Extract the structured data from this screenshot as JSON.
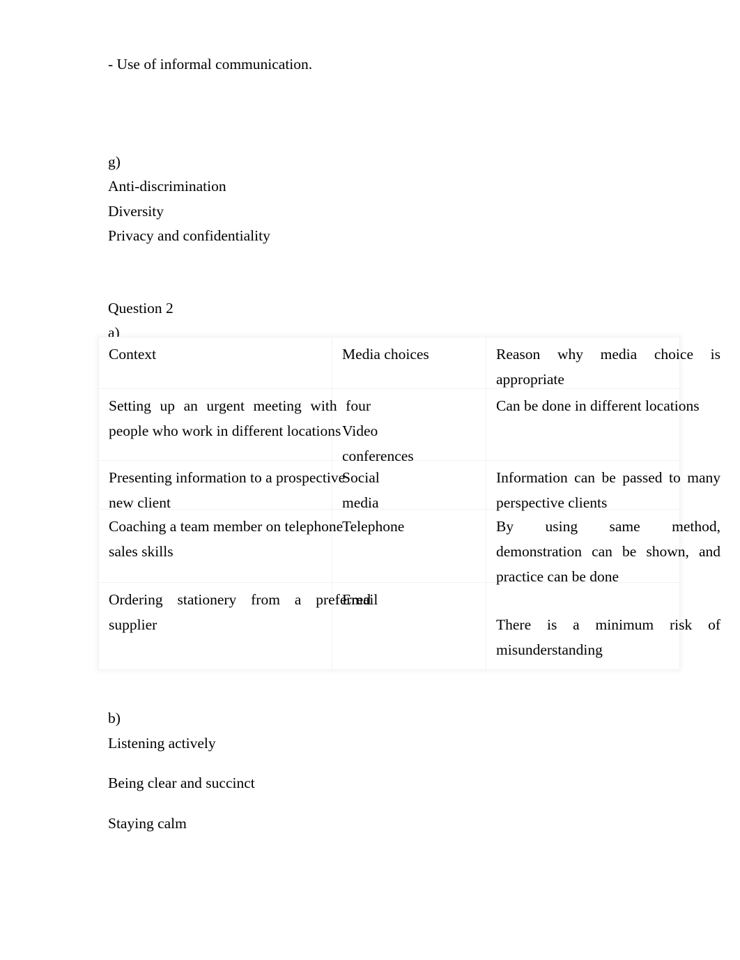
{
  "document": {
    "intro_line": "- Use of informal communication.",
    "section_g": {
      "label": "g)",
      "items": [
        "Anti-discrimination",
        "Diversity",
        "Privacy and confidentiality"
      ]
    },
    "question_2": {
      "title": "Question 2",
      "part_a_label": "a)",
      "table": {
        "headers": [
          "Context",
          "Media choices",
          "Reason why media choice is appropriate"
        ],
        "rows": [
          {
            "context": "Setting up an urgent meeting with four people who work in different locations",
            "media": "Video conferences",
            "reason": "Can be done in different locations"
          },
          {
            "context": "Presenting information to a prospective new client",
            "media": "Social media",
            "reason": "Information can be passed to many perspective clients"
          },
          {
            "context": "Coaching a team member on telephone sales skills",
            "media": "Telephone",
            "reason": "By using same method, demonstration can be shown, and practice can be done"
          },
          {
            "context": "Ordering stationery from a preferred supplier",
            "media": "Email",
            "reason": "There is a minimum risk of misunderstanding"
          }
        ]
      },
      "part_b_label": "b)",
      "part_b_items": [
        "Listening actively",
        "Being clear and succinct",
        "Staying calm"
      ]
    }
  }
}
